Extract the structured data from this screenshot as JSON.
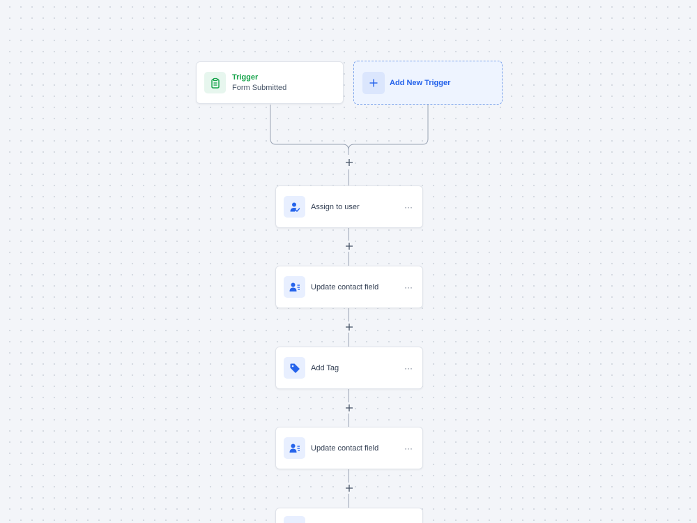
{
  "trigger": {
    "title": "Trigger",
    "subtitle": "Form Submitted",
    "icon": "clipboard-icon",
    "color": "#16a34a"
  },
  "add_trigger": {
    "label": "Add New Trigger",
    "icon": "plus-icon",
    "color": "#2563eb"
  },
  "actions": [
    {
      "label": "Assign to user",
      "icon": "assign-user-icon"
    },
    {
      "label": "Update contact field",
      "icon": "contact-field-icon"
    },
    {
      "label": "Add Tag",
      "icon": "tag-icon"
    },
    {
      "label": "Update contact field",
      "icon": "contact-field-icon"
    },
    {
      "label": "",
      "icon": "action-icon"
    }
  ],
  "more_label": "···",
  "connector_plus": "+",
  "colors": {
    "accent": "#2563eb",
    "trigger": "#16a34a",
    "background": "#f3f5f9"
  }
}
